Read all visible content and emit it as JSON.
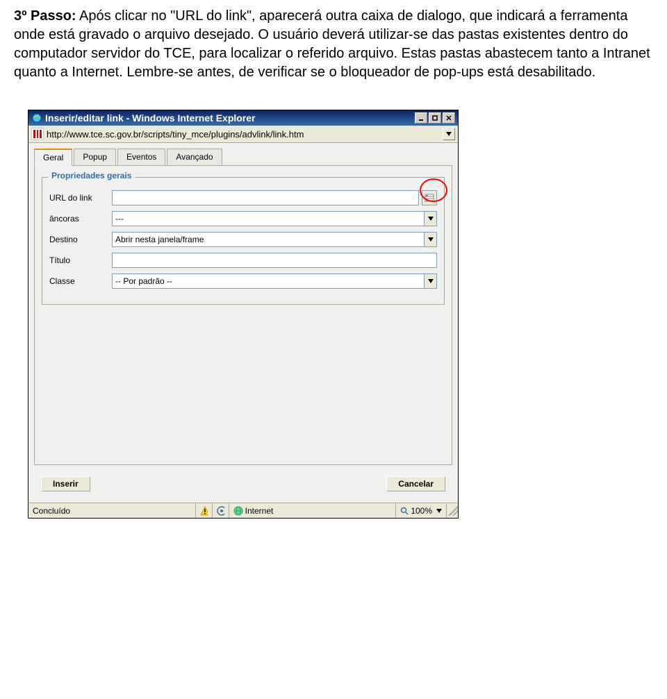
{
  "doc": {
    "title": "3º Passo:",
    "body": " Após clicar no \"URL do link\", aparecerá outra caixa de dialogo, que indicará a ferramenta onde está gravado o arquivo desejado. O usuário deverá utilizar-se das pastas existentes dentro do computador servidor do TCE, para localizar o referido arquivo. Estas pastas abastecem tanto a Intranet quanto a Internet. Lembre-se antes, de verificar se o bloqueador de pop-ups está desabilitado."
  },
  "window": {
    "title": "Inserir/editar link - Windows Internet Explorer",
    "url": "http://www.tce.sc.gov.br/scripts/tiny_mce/plugins/advlink/link.htm"
  },
  "tabs": [
    "Geral",
    "Popup",
    "Eventos",
    "Avançado"
  ],
  "fieldset_legend": "Propriedades gerais",
  "fields": {
    "url_label": "URL do link",
    "url_value": "",
    "anchors_label": "âncoras",
    "anchors_value": "---",
    "target_label": "Destino",
    "target_value": "Abrir nesta janela/frame",
    "title_label": "Título",
    "title_value": "",
    "class_label": "Classe",
    "class_value": "-- Por padrão --"
  },
  "buttons": {
    "insert": "Inserir",
    "cancel": "Cancelar"
  },
  "status": {
    "done": "Concluído",
    "zone": "Internet",
    "zoom": "100%"
  }
}
